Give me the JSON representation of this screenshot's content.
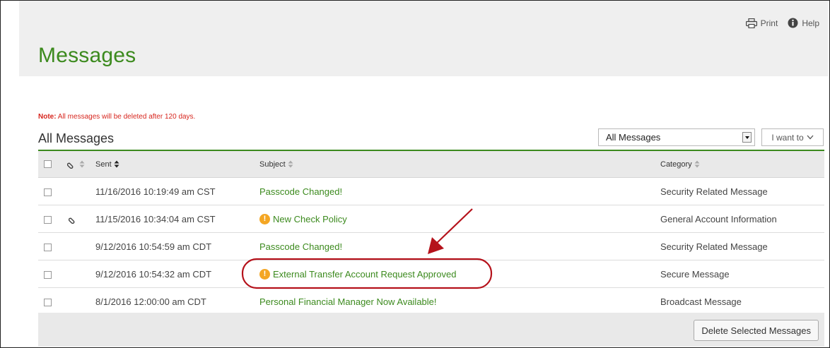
{
  "toolbar": {
    "print_label": "Print",
    "help_label": "Help"
  },
  "page": {
    "title": "Messages"
  },
  "note": {
    "prefix": "Note:",
    "text": " All messages will be deleted after 120 days."
  },
  "list": {
    "title": "All Messages",
    "filter_value": "All Messages",
    "i_want_label": "I want to",
    "columns": {
      "sent": "Sent",
      "subject": "Subject",
      "category": "Category"
    },
    "rows": [
      {
        "sent": "11/16/2016 10:19:49 am CST",
        "subject": "Passcode Changed!",
        "category": "Security Related Message",
        "attachment": false,
        "alert": false
      },
      {
        "sent": "11/15/2016 10:34:04 am CST",
        "subject": "New Check Policy",
        "category": "General Account Information",
        "attachment": true,
        "alert": true
      },
      {
        "sent": "9/12/2016 10:54:59 am CDT",
        "subject": "Passcode Changed!",
        "category": "Security Related Message",
        "attachment": false,
        "alert": false
      },
      {
        "sent": "9/12/2016 10:54:32 am CDT",
        "subject": "External Transfer Account Request Approved",
        "category": "Secure Message",
        "attachment": false,
        "alert": true
      },
      {
        "sent": "8/1/2016 12:00:00 am CDT",
        "subject": "Personal Financial Manager Now Available!",
        "category": "Broadcast Message",
        "attachment": false,
        "alert": false
      }
    ],
    "delete_label": "Delete Selected Messages"
  },
  "colors": {
    "brand_green": "#3c8a1e",
    "note_red": "#d7261e",
    "alert_orange": "#f4a623",
    "annotation_red": "#b5121b"
  }
}
